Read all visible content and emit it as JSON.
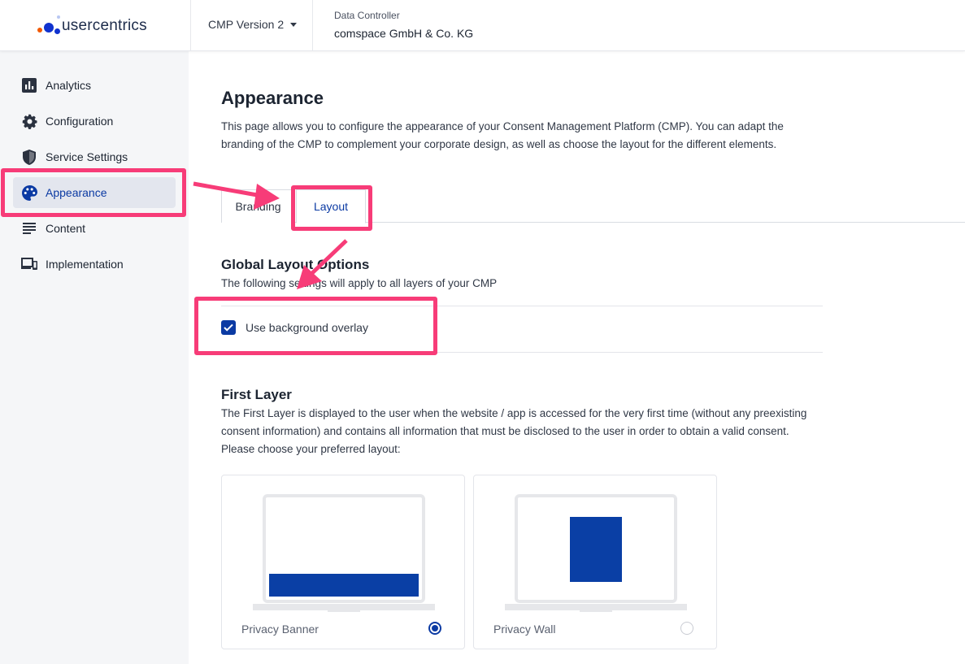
{
  "header": {
    "logo_text": "usercentrics",
    "cmp_version": "CMP Version 2",
    "data_controller_label": "Data Controller",
    "data_controller_value": "comspace GmbH & Co. KG"
  },
  "sidebar": {
    "items": [
      {
        "label": "Analytics",
        "icon": "bar-chart-icon"
      },
      {
        "label": "Configuration",
        "icon": "gear-icon"
      },
      {
        "label": "Service Settings",
        "icon": "shield-icon"
      },
      {
        "label": "Appearance",
        "icon": "palette-icon",
        "active": true
      },
      {
        "label": "Content",
        "icon": "text-lines-icon"
      },
      {
        "label": "Implementation",
        "icon": "devices-icon"
      }
    ]
  },
  "main": {
    "title": "Appearance",
    "description": "This page allows you to configure the appearance of your Consent Management Platform (CMP). You can adapt the branding of the CMP to complement your corporate design, as well as choose the layout for the different elements.",
    "tabs": [
      {
        "label": "Branding",
        "active": false
      },
      {
        "label": "Layout",
        "active": true
      }
    ],
    "global_layout": {
      "title": "Global Layout Options",
      "description": "The following settings will apply to all layers of your CMP",
      "overlay_label": "Use background overlay",
      "overlay_checked": true
    },
    "first_layer": {
      "title": "First Layer",
      "description": "The First Layer is displayed to the user when the website / app is accessed for the very first time (without any preexisting consent information) and contains all information that must be disclosed to the user in order to obtain a valid consent. Please choose your preferred layout:",
      "options": [
        {
          "label": "Privacy Banner",
          "selected": true
        },
        {
          "label": "Privacy Wall",
          "selected": false
        }
      ]
    }
  },
  "colors": {
    "accent": "#0b3aa3",
    "highlight": "#f73c78",
    "sidebar_bg": "#f5f6f8"
  }
}
